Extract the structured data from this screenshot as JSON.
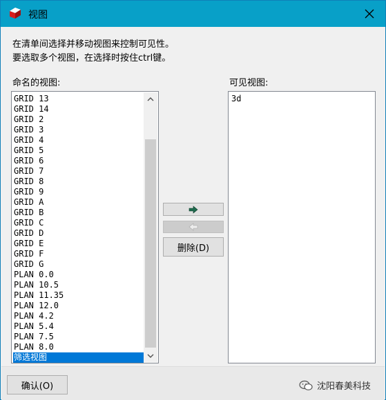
{
  "window": {
    "title": "视图",
    "close_icon": "close-icon",
    "app_icon": "app-logo-icon"
  },
  "instructions": {
    "line1": "在清单间选择并移动视图来控制可见性。",
    "line2": "要选取多个视图，在选择时按住ctrl键。"
  },
  "named_views": {
    "label": "命名的视图:",
    "items": [
      "GRID 13",
      "GRID 14",
      "GRID 2",
      "GRID 3",
      "GRID 4",
      "GRID 5",
      "GRID 6",
      "GRID 7",
      "GRID 8",
      "GRID 9",
      "GRID A",
      "GRID B",
      "GRID C",
      "GRID D",
      "GRID E",
      "GRID F",
      "GRID G",
      "PLAN 0.0",
      "PLAN 10.5",
      "PLAN 11.35",
      "PLAN 12.0",
      "PLAN 4.2",
      "PLAN 5.4",
      "PLAN 7.5",
      "PLAN 8.0",
      "筛选视图"
    ],
    "selected_index": 25
  },
  "visible_views": {
    "label": "可见视图:",
    "items": [
      "3d"
    ]
  },
  "buttons": {
    "add_icon": "arrow-right-icon",
    "remove_icon": "arrow-left-icon",
    "delete_label": "删除(D)",
    "ok_label": "确认(O)"
  },
  "watermark": {
    "text": "沈阳春美科技"
  },
  "colors": {
    "titlebar": "#08a0c8",
    "selection": "#0078d7",
    "arrow_enabled": "#1f6b4e"
  }
}
